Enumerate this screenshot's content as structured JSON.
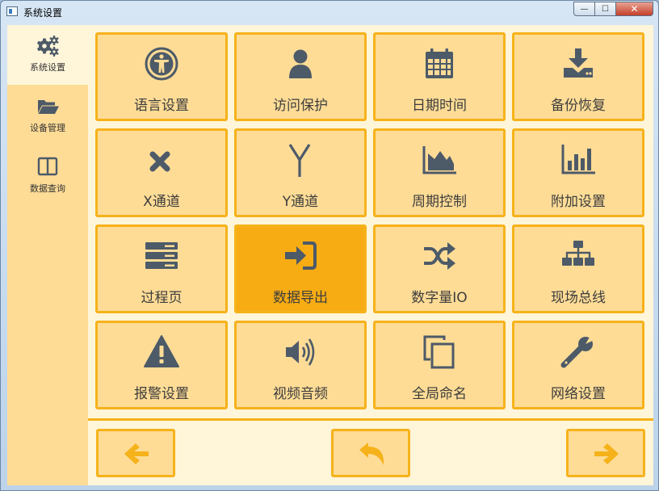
{
  "window": {
    "title": "系统设置",
    "controls": {
      "minimize": "—",
      "maximize": "☐",
      "close": "✕"
    }
  },
  "sidebar": {
    "items": [
      {
        "label": "系统设置",
        "icon": "gears-icon",
        "active": true
      },
      {
        "label": "设备管理",
        "icon": "folder-open-icon",
        "active": false
      },
      {
        "label": "数据查询",
        "icon": "columns-icon",
        "active": false
      }
    ]
  },
  "tiles": [
    {
      "label": "语言设置",
      "icon": "accessibility-icon"
    },
    {
      "label": "访问保护",
      "icon": "user-icon"
    },
    {
      "label": "日期时间",
      "icon": "calendar-icon"
    },
    {
      "label": "备份恢复",
      "icon": "download-drive-icon"
    },
    {
      "label": "X通道",
      "icon": "x-icon"
    },
    {
      "label": "Y通道",
      "icon": "y-letter-icon"
    },
    {
      "label": "周期控制",
      "icon": "area-chart-icon"
    },
    {
      "label": "附加设置",
      "icon": "bar-chart-icon"
    },
    {
      "label": "过程页",
      "icon": "server-icon"
    },
    {
      "label": "数据导出",
      "icon": "sign-in-icon",
      "selected": true
    },
    {
      "label": "数字量IO",
      "icon": "random-icon"
    },
    {
      "label": "现场总线",
      "icon": "sitemap-icon"
    },
    {
      "label": "报警设置",
      "icon": "warning-icon"
    },
    {
      "label": "视频音频",
      "icon": "volume-icon"
    },
    {
      "label": "全局命名",
      "icon": "copy-icon"
    },
    {
      "label": "网络设置",
      "icon": "wrench-icon"
    }
  ],
  "nav": {
    "prev": "arrow-left-icon",
    "back": "reply-icon",
    "next": "arrow-right-icon"
  },
  "colors": {
    "tile_bg": "#fedc96",
    "tile_border": "#f6b21a",
    "tile_selected": "#f7ac14",
    "icon": "#4d5a68",
    "arrow": "#f6b21a",
    "page_bg": "#fff5d9"
  }
}
